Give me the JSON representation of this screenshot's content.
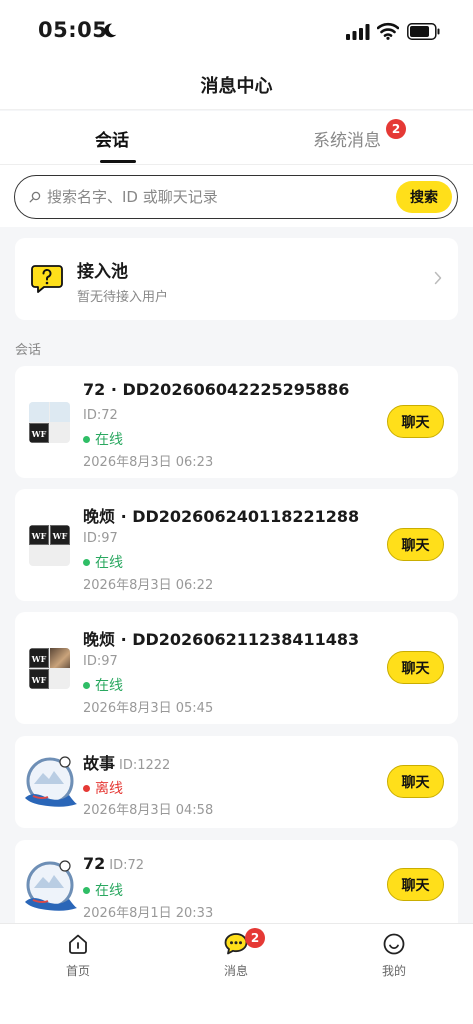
{
  "status_bar": {
    "time": "05:05"
  },
  "header": {
    "title": "消息中心"
  },
  "tabs": [
    {
      "label": "会话",
      "active": true
    },
    {
      "label": "系统消息",
      "badge": "2"
    }
  ],
  "search": {
    "placeholder": "搜索名字、ID 或聊天记录",
    "button_label": "搜索"
  },
  "pool": {
    "title": "接入池",
    "subtitle": "暂无待接入用户"
  },
  "section_label": "会话",
  "conversations": [
    {
      "name": "72 · DD202606042225295886",
      "id_text": "ID:72",
      "status": "在线",
      "online": true,
      "time": "2026年8月3日 06:23",
      "button": "聊天"
    },
    {
      "name": "晚烦 · DD202606240118221288",
      "id_text": "ID:97",
      "status": "在线",
      "online": true,
      "time": "2026年8月3日 06:22",
      "button": "聊天"
    },
    {
      "name": "晚烦 · DD202606211238411483",
      "id_text": "ID:97",
      "status": "在线",
      "online": true,
      "time": "2026年8月3日 05:45",
      "button": "聊天"
    },
    {
      "name": "故事",
      "id_text": "ID:1222",
      "status": "离线",
      "online": false,
      "time": "2026年8月3日 04:58",
      "button": "聊天"
    },
    {
      "name": "72",
      "id_text": "ID:72",
      "status": "在线",
      "online": true,
      "time": "2026年8月1日 20:33",
      "button": "聊天"
    }
  ],
  "avatar_text": "WF",
  "bottom_nav": [
    {
      "label": "首页"
    },
    {
      "label": "消息",
      "badge": "2"
    },
    {
      "label": "我的"
    }
  ],
  "colors": {
    "accent": "#ffdf1a",
    "online": "#2fbe66",
    "offline": "#e53935",
    "badge": "#e53935"
  }
}
